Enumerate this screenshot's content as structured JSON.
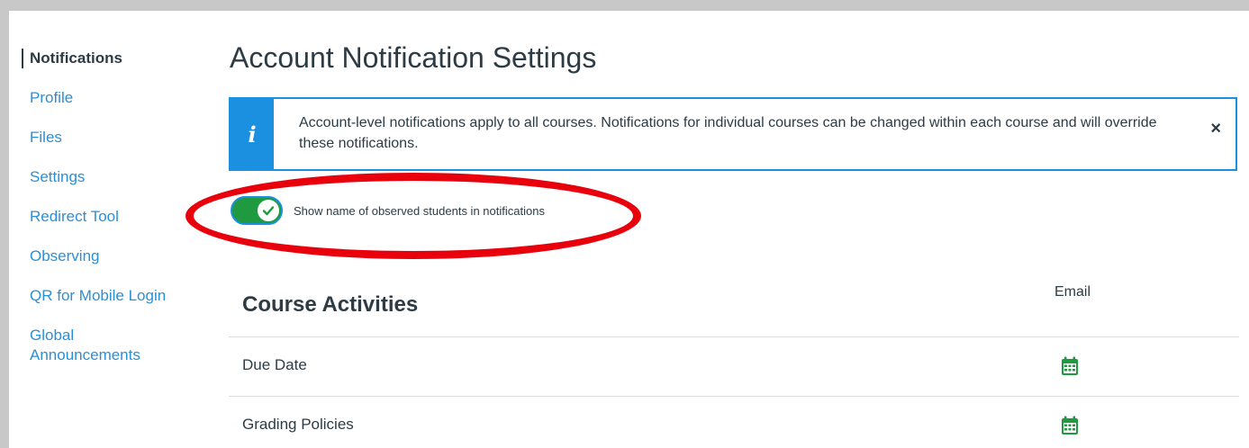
{
  "sidebar": {
    "items": [
      {
        "label": "Notifications",
        "active": true
      },
      {
        "label": "Profile"
      },
      {
        "label": "Files"
      },
      {
        "label": "Settings"
      },
      {
        "label": "Redirect Tool"
      },
      {
        "label": "Observing"
      },
      {
        "label": "QR for Mobile Login"
      },
      {
        "label": "Global Announcements"
      }
    ]
  },
  "page": {
    "title": "Account Notification Settings"
  },
  "alert": {
    "icon": "info-icon",
    "text": "Account-level notifications apply to all courses. Notifications for individual courses can be changed within each course and will override these notifications.",
    "close_label": "×"
  },
  "toggle": {
    "label": "Show name of observed students in notifications",
    "checked": true,
    "on_color": "#1f9a40"
  },
  "annotation": {
    "color": "#e8000c"
  },
  "table": {
    "section_title": "Course Activities",
    "columns": [
      "Email"
    ],
    "rows": [
      {
        "label": "Due Date",
        "email_icon": "calendar-icon"
      },
      {
        "label": "Grading Policies",
        "email_icon": "calendar-icon"
      }
    ]
  },
  "colors": {
    "link": "#2b8fd6",
    "text": "#2d3b45",
    "brand_blue": "#1b8fe0",
    "success_green": "#1f9a40"
  }
}
